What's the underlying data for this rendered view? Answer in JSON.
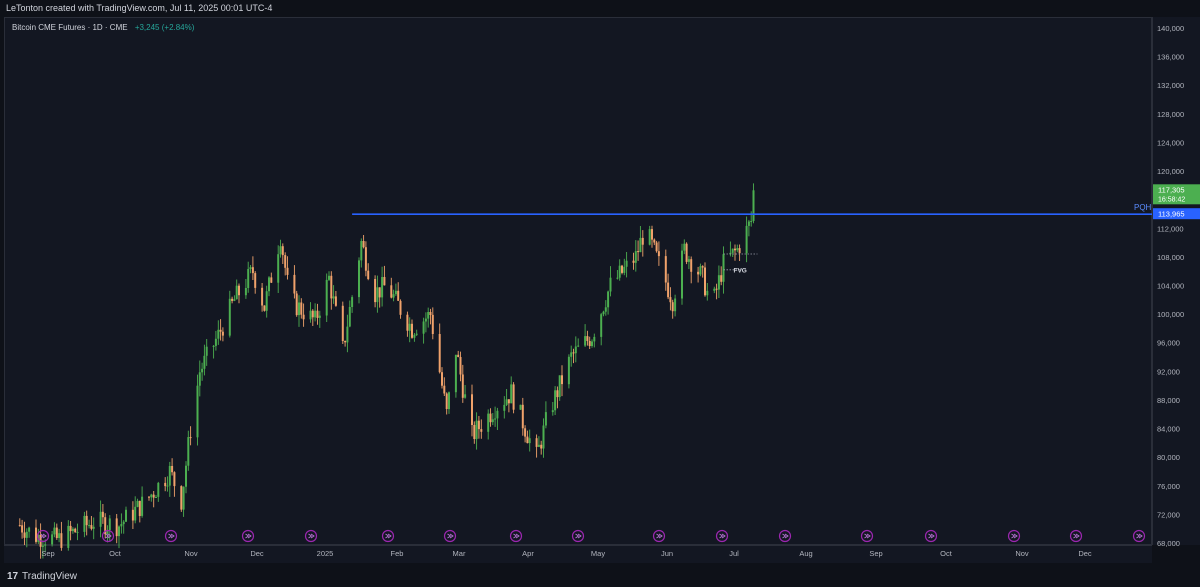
{
  "header": {
    "attribution": "LeTonton created with TradingView.com, Jul 11, 2025 00:01 UTC-4"
  },
  "symbol": {
    "title": "Bitcoin CME Futures · 1D · CME",
    "change": "+3,245 (+2.84%)"
  },
  "footer": {
    "logo": "17",
    "brand": "TradingView"
  },
  "labels": {
    "pqh": "PQH",
    "fvg": "FVG"
  },
  "colors": {
    "up": "#26a69a",
    "up_body": "#4caf50",
    "down": "#f0a26b",
    "level_line": "#2962ff",
    "price_tag": "#4caf50",
    "background": "#131722"
  },
  "price_axis": {
    "ticks": [
      "140,000",
      "136,000",
      "132,000",
      "128,000",
      "124,000",
      "120,000",
      "116,000",
      "112,000",
      "108,000",
      "104,000",
      "100,000",
      "96,000",
      "92,000",
      "88,000",
      "84,000",
      "80,000",
      "76,000",
      "72,000",
      "68,000"
    ],
    "last_price": "117,305",
    "countdown": "16:58:42",
    "level_price": "113,965"
  },
  "time_axis": {
    "ticks": [
      "Sep",
      "Oct",
      "Nov",
      "Dec",
      "2025",
      "Feb",
      "Mar",
      "Apr",
      "May",
      "Jun",
      "Jul",
      "Aug",
      "Sep",
      "Oct",
      "Nov",
      "Dec"
    ]
  },
  "chart_data": {
    "type": "candlestick",
    "title": "Bitcoin CME Futures · 1D · CME",
    "ylim": [
      68000,
      140000
    ],
    "levels": [
      {
        "label": "PQH",
        "price": 113965
      }
    ],
    "zones": [
      {
        "label": "FVG",
        "top": 108400,
        "bottom": 106200
      }
    ],
    "anchors": [
      {
        "date": "Aug 26",
        "price": 70500
      },
      {
        "date": "Sep 02",
        "price": 69000
      },
      {
        "date": "Sep 12",
        "price": 68500
      },
      {
        "date": "Sep 27",
        "price": 71000
      },
      {
        "date": "Oct 08",
        "price": 70500
      },
      {
        "date": "Oct 20",
        "price": 74000
      },
      {
        "date": "Oct 30",
        "price": 78000
      },
      {
        "date": "Nov 04",
        "price": 74000
      },
      {
        "date": "Nov 08",
        "price": 84000
      },
      {
        "date": "Nov 12",
        "price": 92000
      },
      {
        "date": "Nov 20",
        "price": 97000
      },
      {
        "date": "Nov 27",
        "price": 102000
      },
      {
        "date": "Dec 05",
        "price": 106000
      },
      {
        "date": "Dec 10",
        "price": 101000
      },
      {
        "date": "Dec 17",
        "price": 111000
      },
      {
        "date": "Dec 21",
        "price": 102000
      },
      {
        "date": "Jan 01",
        "price": 99000
      },
      {
        "date": "Jan 07",
        "price": 105000
      },
      {
        "date": "Jan 13",
        "price": 95000
      },
      {
        "date": "Jan 21",
        "price": 110000
      },
      {
        "date": "Jan 27",
        "price": 103000
      },
      {
        "date": "Feb 01",
        "price": 104000
      },
      {
        "date": "Feb 12",
        "price": 98000
      },
      {
        "date": "Feb 20",
        "price": 100000
      },
      {
        "date": "Feb 27",
        "price": 86000
      },
      {
        "date": "Mar 03",
        "price": 95000
      },
      {
        "date": "Mar 10",
        "price": 83000
      },
      {
        "date": "Mar 20",
        "price": 87000
      },
      {
        "date": "Mar 27",
        "price": 89000
      },
      {
        "date": "Apr 07",
        "price": 80000
      },
      {
        "date": "Apr 12",
        "price": 86000
      },
      {
        "date": "Apr 22",
        "price": 94000
      },
      {
        "date": "May 01",
        "price": 97000
      },
      {
        "date": "May 09",
        "price": 104000
      },
      {
        "date": "May 20",
        "price": 108000
      },
      {
        "date": "May 24",
        "price": 112000
      },
      {
        "date": "Jun 05",
        "price": 102000
      },
      {
        "date": "Jun 10",
        "price": 109000
      },
      {
        "date": "Jun 18",
        "price": 105000
      },
      {
        "date": "Jun 22",
        "price": 101000
      },
      {
        "date": "Jun 27",
        "price": 107000
      },
      {
        "date": "Jul 03",
        "price": 109000
      },
      {
        "date": "Jul 09",
        "price": 113000
      },
      {
        "date": "Jul 10",
        "price": 117305
      }
    ]
  }
}
